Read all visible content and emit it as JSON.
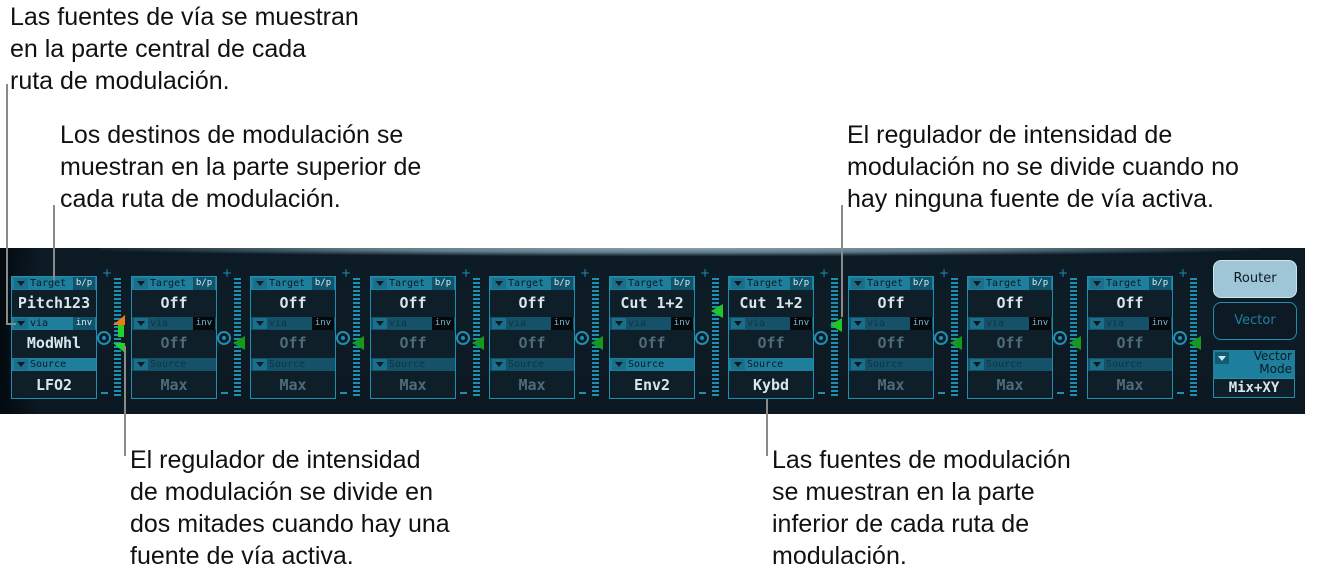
{
  "annotations": {
    "via_sources": "Las fuentes de vía se muestran\nen la parte central de cada\nruta de modulación.",
    "targets": "Los destinos de modulación se\nmuestran en la parte superior de\ncada ruta de modulación.",
    "not_split": "El regulador de intensidad de\nmodulación no se divide cuando no\nhay ninguna fuente de vía activa.",
    "split": "El regulador de intensidad\nde modulación se divide en\ndos mitades cuando hay una\nfuente de vía activa.",
    "sources": "Las fuentes de modulación\nse muestran en la parte\ninferior de cada ruta de\nmodulación."
  },
  "labels": {
    "target": "Target",
    "bp": "b/p",
    "via": "via",
    "inv": "inv",
    "source": "Source"
  },
  "slots": [
    {
      "target": "Pitch123",
      "via": "ModWhl",
      "source": "LFO2",
      "via_active": true,
      "target_active": true,
      "source_active": true
    },
    {
      "target": "Off",
      "via": "Off",
      "source": "Max",
      "via_active": false,
      "target_active": true,
      "source_active": false
    },
    {
      "target": "Off",
      "via": "Off",
      "source": "Max",
      "via_active": false,
      "target_active": true,
      "source_active": false
    },
    {
      "target": "Off",
      "via": "Off",
      "source": "Max",
      "via_active": false,
      "target_active": true,
      "source_active": false
    },
    {
      "target": "Off",
      "via": "Off",
      "source": "Max",
      "via_active": false,
      "target_active": true,
      "source_active": false
    },
    {
      "target": "Cut 1+2",
      "via": "Off",
      "source": "Env2",
      "via_active": false,
      "target_active": true,
      "source_active": true
    },
    {
      "target": "Cut 1+2",
      "via": "Off",
      "source": "Kybd",
      "via_active": false,
      "target_active": true,
      "source_active": true
    },
    {
      "target": "Off",
      "via": "Off",
      "source": "Max",
      "via_active": false,
      "target_active": true,
      "source_active": false
    },
    {
      "target": "Off",
      "via": "Off",
      "source": "Max",
      "via_active": false,
      "target_active": true,
      "source_active": false
    },
    {
      "target": "Off",
      "via": "Off",
      "source": "Max",
      "via_active": false,
      "target_active": true,
      "source_active": false
    }
  ],
  "sliders": [
    {
      "split": true,
      "upper_level": 0.6,
      "lower_level": 0.45,
      "active": true
    },
    {
      "split": false,
      "level": 0.45,
      "active": false
    },
    {
      "split": false,
      "level": 0.45,
      "active": false
    },
    {
      "split": false,
      "level": 0.45,
      "active": false
    },
    {
      "split": false,
      "level": 0.45,
      "active": false
    },
    {
      "split": false,
      "level": 0.72,
      "active": true
    },
    {
      "split": false,
      "level": 0.6,
      "active": true
    },
    {
      "split": false,
      "level": 0.45,
      "active": false
    },
    {
      "split": false,
      "level": 0.45,
      "active": false
    },
    {
      "split": false,
      "level": 0.45,
      "active": false
    }
  ],
  "buttons": {
    "router": "Router",
    "vector": "Vector"
  },
  "vector_mode": {
    "label": "Vector\nMode",
    "value": "Mix+XY"
  }
}
